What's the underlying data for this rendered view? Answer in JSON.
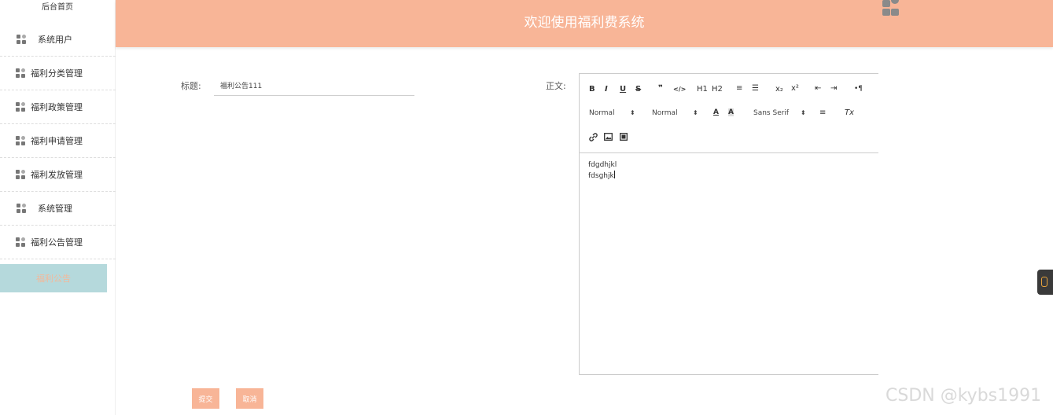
{
  "sidebar": {
    "title": "后台首页",
    "items": [
      {
        "label": "系统用户"
      },
      {
        "label": "福利分类管理"
      },
      {
        "label": "福利政策管理"
      },
      {
        "label": "福利申请管理"
      },
      {
        "label": "福利发放管理"
      },
      {
        "label": "系统管理"
      },
      {
        "label": "福利公告管理"
      }
    ],
    "active_item": "福利公告"
  },
  "header": {
    "title": "欢迎使用福利费系统"
  },
  "form": {
    "title_label": "标题:",
    "title_value": "福利公告111",
    "body_label": "正文:",
    "submit_label": "提交",
    "cancel_label": "取消"
  },
  "editor": {
    "toolbar": {
      "bold": "B",
      "italic": "I",
      "underline": "U",
      "strike": "S",
      "blockquote": "❞",
      "code": "</>",
      "h1": "H1",
      "h2": "H2",
      "ordered_list": "≡",
      "bullet_list": "☰",
      "subscript": "x₂",
      "superscript": "x²",
      "outdent": "⇤",
      "indent": "⇥",
      "direction": "•¶",
      "size_value": "Normal",
      "header_value": "Normal",
      "font_value": "Sans Serif",
      "color": "A",
      "background": "A",
      "align": "≡",
      "clean": "Tx"
    },
    "content_lines": [
      "fdgdhjkl",
      "fdsghjk"
    ]
  },
  "watermark": "CSDN @kybs1991",
  "colors": {
    "header_bg": "#f8b597",
    "active_item_bg": "#b5d9dc",
    "button_bg": "#f8b597"
  }
}
